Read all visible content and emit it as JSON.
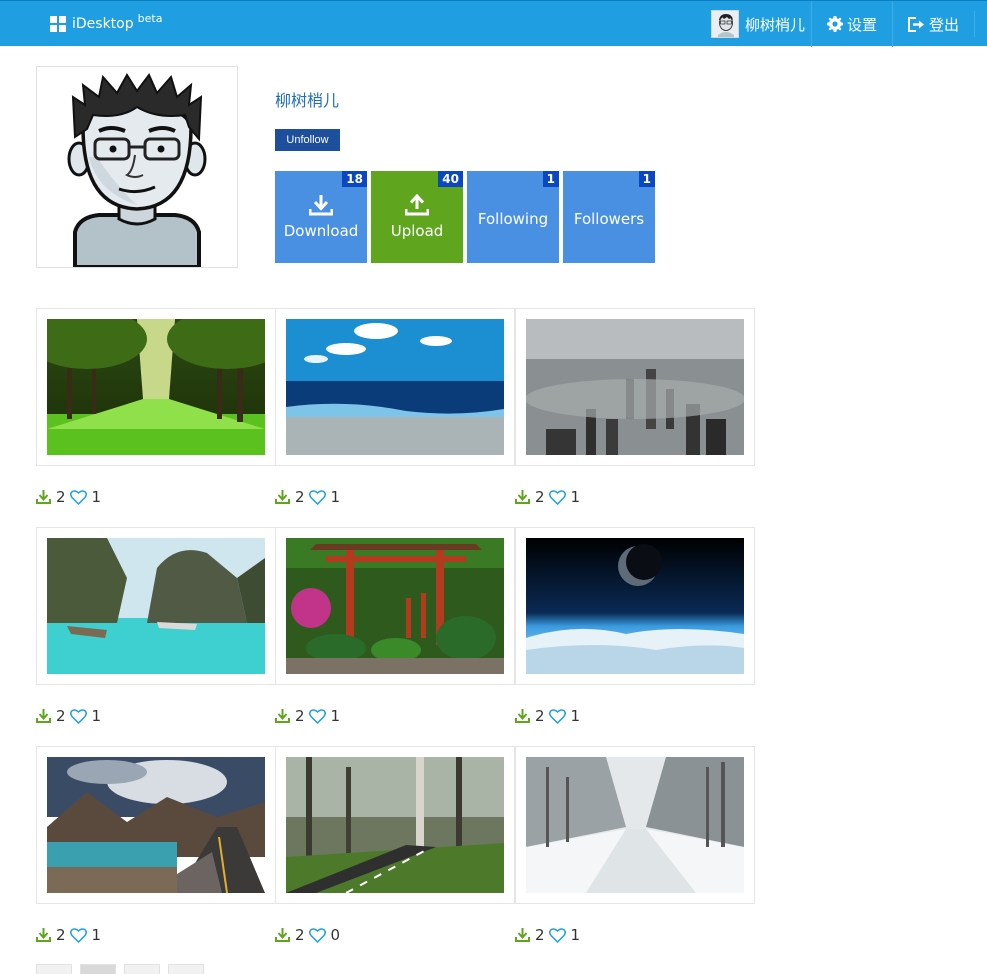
{
  "header": {
    "brand": "iDesktop",
    "brand_sup": "beta",
    "user_name": "柳树梢儿",
    "settings_label": "设置",
    "logout_label": "登出",
    "bar_color": "#1f9fe1"
  },
  "profile": {
    "name": "柳树梢儿",
    "unfollow_label": "Unfollow",
    "tiles": [
      {
        "label": "Download",
        "count": "18",
        "icon": "download-icon",
        "color": "#4a90e2"
      },
      {
        "label": "Upload",
        "count": "40",
        "icon": "upload-icon",
        "color": "#5fa61e"
      },
      {
        "label": "Following",
        "count": "1",
        "icon": "",
        "color": "#4a90e2"
      },
      {
        "label": "Followers",
        "count": "1",
        "icon": "",
        "color": "#4a90e2"
      }
    ]
  },
  "gallery": [
    {
      "downloads": "2",
      "likes": "1",
      "scene": "tree-lined-path"
    },
    {
      "downloads": "2",
      "likes": "1",
      "scene": "ocean-beach"
    },
    {
      "downloads": "2",
      "likes": "1",
      "scene": "foggy-city"
    },
    {
      "downloads": "2",
      "likes": "1",
      "scene": "tropical-bay"
    },
    {
      "downloads": "2",
      "likes": "1",
      "scene": "torii-garden"
    },
    {
      "downloads": "2",
      "likes": "1",
      "scene": "planet-earth"
    },
    {
      "downloads": "2",
      "likes": "1",
      "scene": "mountain-road"
    },
    {
      "downloads": "2",
      "likes": "0",
      "scene": "forest-road"
    },
    {
      "downloads": "2",
      "likes": "1",
      "scene": "snowy-avenue"
    }
  ],
  "icons": {
    "download_stat": "download-icon",
    "like_stat": "heart-icon"
  }
}
